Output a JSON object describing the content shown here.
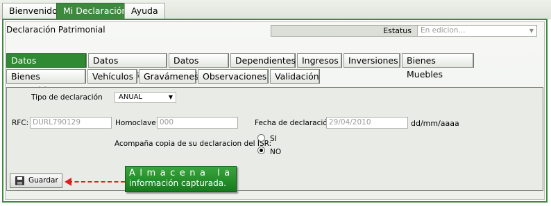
{
  "top_tabs": [
    {
      "label": "Bienvenido",
      "active": false
    },
    {
      "label": "Mi Declaración",
      "active": true
    },
    {
      "label": "Ayuda",
      "active": false
    }
  ],
  "header": {
    "title": "Declaración Patrimonial",
    "estatus_label": "Estatus",
    "estatus_value": "En edicion..."
  },
  "tabs_row1": [
    {
      "label": "Datos Declaración",
      "active": true
    },
    {
      "label": "Datos Personales"
    },
    {
      "label": "Datos Puesto"
    },
    {
      "label": "Dependientes"
    },
    {
      "label": "Ingresos"
    },
    {
      "label": "Inversiones"
    },
    {
      "label": "Bienes Muebles"
    }
  ],
  "tabs_row2": [
    {
      "label": "Bienes Inmuebles"
    },
    {
      "label": "Vehículos"
    },
    {
      "label": "Gravámenes"
    },
    {
      "label": "Observaciones"
    },
    {
      "label": "Validación"
    }
  ],
  "form": {
    "tipo_label": "Tipo de declaración",
    "tipo_value": "ANUAL",
    "rfc_label": "RFC:",
    "rfc_value": "DURL790129",
    "homoclave_label": "Homoclave:",
    "homoclave_value": "000",
    "fecha_label": "Fecha de declaración:",
    "fecha_value": "29/04/2010",
    "fecha_format": "dd/mm/aaaa",
    "isr_label": "Acompaña copia de su declaracion del ISR:",
    "option_si": "SI",
    "option_no": "NO",
    "selected": "NO"
  },
  "save_label": "Guardar",
  "callout": {
    "line1": "Almacena la",
    "line2": "información capturada."
  },
  "colors": {
    "active_tab": "#2f8a33",
    "frame": "#3d8a3e",
    "arrow": "#e11d1d"
  }
}
